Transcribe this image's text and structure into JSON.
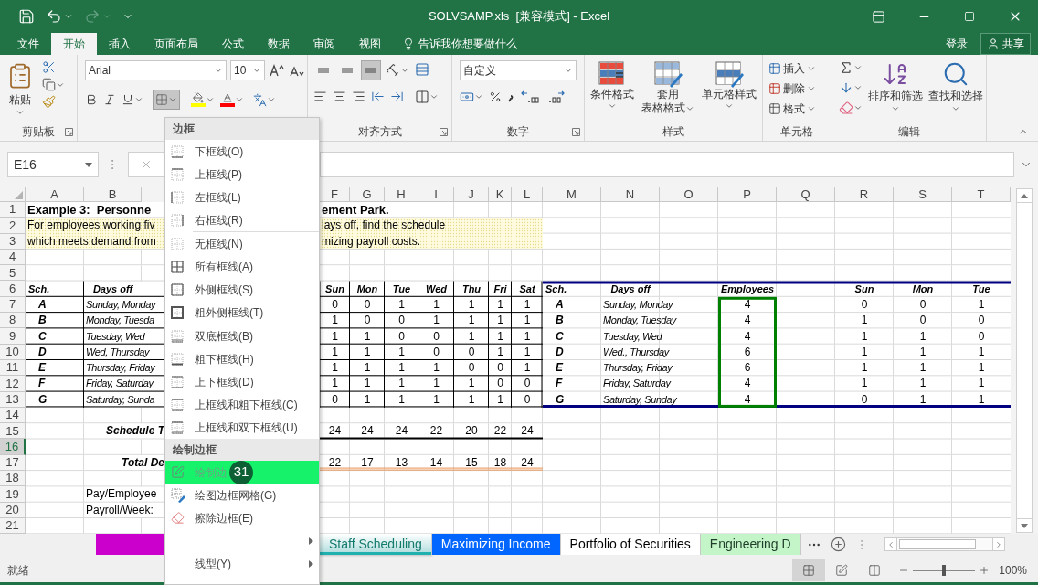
{
  "title_bar": {
    "title": "SOLVSAMP.xls  [兼容模式] - Excel",
    "redo_disabled": true
  },
  "menu_tabs": [
    {
      "label": "文件",
      "selected": false
    },
    {
      "label": "开始",
      "selected": true
    },
    {
      "label": "插入",
      "selected": false
    },
    {
      "label": "页面布局",
      "selected": false
    },
    {
      "label": "公式",
      "selected": false
    },
    {
      "label": "数据",
      "selected": false
    },
    {
      "label": "审阅",
      "selected": false
    },
    {
      "label": "视图",
      "selected": false
    }
  ],
  "tell_me": "告诉我你想要做什么",
  "sign_in": "登录",
  "share": "共享",
  "ribbon": {
    "clipboard": {
      "paste": "粘贴",
      "label": "剪贴板"
    },
    "font": {
      "name": "Arial",
      "size": "10",
      "borders_open": true
    },
    "alignment": {
      "vertical": [
        {
          "selected": false
        },
        {
          "selected": false
        },
        {
          "selected": true
        }
      ],
      "label": "对齐方式"
    },
    "number": {
      "format": "自定义",
      "label": "数字"
    },
    "styles": {
      "buttons": [
        {
          "label": "条件格式"
        },
        {
          "label": "套用",
          "label2": "表格格式"
        },
        {
          "label": "单元格样式"
        }
      ],
      "label": "样式"
    },
    "cells": {
      "buttons": [
        {
          "label": "插入"
        },
        {
          "label": "删除"
        },
        {
          "label": "格式"
        }
      ],
      "label": "单元格"
    },
    "editing": {
      "buttons": [
        {
          "label": "排序和筛选"
        },
        {
          "label": "查找和选择"
        }
      ],
      "label": "编辑"
    }
  },
  "formula_bar": {
    "name_box": "E16"
  },
  "column_headers": [
    "A",
    "B",
    "F",
    "G",
    "H",
    "I",
    "J",
    "K",
    "L",
    "M",
    "N",
    "O",
    "P",
    "Q",
    "R",
    "S",
    "T"
  ],
  "rows": [
    {
      "header": "1",
      "selected": false,
      "kind": "title",
      "cells": [
        "Example 3:  Personne",
        null,
        null,
        null,
        "ement Park."
      ]
    },
    {
      "header": "2",
      "selected": false,
      "kind": "note",
      "cells": [
        "For employees working fiv",
        null,
        null,
        null,
        "lays off, find the schedule"
      ]
    },
    {
      "header": "3",
      "selected": false,
      "kind": "note",
      "cells": [
        "which meets demand from",
        null,
        null,
        null,
        "mizing payroll costs."
      ]
    },
    {
      "header": "4",
      "selected": false,
      "kind": "blank"
    },
    {
      "header": "5",
      "selected": false,
      "kind": "blank"
    },
    {
      "header": "6",
      "selected": false,
      "kind": "header",
      "cells": [
        "Sch.",
        "Days off",
        null,
        null,
        "Sun",
        "Mon",
        "Tue",
        "Wed",
        "Thu",
        "Fri",
        "Sat",
        "Sch.",
        "Days off",
        null,
        "Employees",
        null,
        "Sun",
        "Mon",
        "Tue"
      ]
    },
    {
      "header": "7",
      "selected": false,
      "kind": "data",
      "cells": [
        "A",
        "Sunday, Monday",
        null,
        null,
        "0",
        "0",
        "1",
        "1",
        "1",
        "1",
        "1",
        "A",
        "Sunday, Monday",
        null,
        "4",
        null,
        "0",
        "0",
        "1"
      ]
    },
    {
      "header": "8",
      "selected": false,
      "kind": "data",
      "cells": [
        "B",
        "Monday, Tuesda",
        null,
        null,
        "1",
        "0",
        "0",
        "1",
        "1",
        "1",
        "1",
        "B",
        "Monday, Tuesday",
        null,
        "4",
        null,
        "1",
        "0",
        "0"
      ]
    },
    {
      "header": "9",
      "selected": false,
      "kind": "data",
      "cells": [
        "C",
        "Tuesday, Wed",
        null,
        null,
        "1",
        "1",
        "0",
        "0",
        "1",
        "1",
        "1",
        "C",
        "Tuesday, Wed",
        null,
        "4",
        null,
        "1",
        "1",
        "0"
      ]
    },
    {
      "header": "10",
      "selected": false,
      "kind": "data",
      "cells": [
        "D",
        "Wed, Thursday",
        null,
        null,
        "1",
        "1",
        "1",
        "0",
        "0",
        "1",
        "1",
        "D",
        "Wed., Thursday",
        null,
        "6",
        null,
        "1",
        "1",
        "1"
      ]
    },
    {
      "header": "11",
      "selected": false,
      "kind": "data",
      "cells": [
        "E",
        "Thursday, Friday",
        null,
        null,
        "1",
        "1",
        "1",
        "1",
        "0",
        "0",
        "1",
        "E",
        "Thursday, Friday",
        null,
        "6",
        null,
        "1",
        "1",
        "1"
      ]
    },
    {
      "header": "12",
      "selected": false,
      "kind": "data",
      "cells": [
        "F",
        "Friday, Saturday",
        null,
        null,
        "1",
        "1",
        "1",
        "1",
        "1",
        "0",
        "0",
        "F",
        "Friday, Saturday",
        null,
        "4",
        null,
        "1",
        "1",
        "1"
      ]
    },
    {
      "header": "13",
      "selected": false,
      "kind": "data_last",
      "cells": [
        "G",
        "Saturday, Sunda",
        null,
        null,
        "0",
        "1",
        "1",
        "1",
        "1",
        "1",
        "0",
        "G",
        "Saturday, Sunday",
        null,
        "4",
        null,
        "0",
        "1",
        "1"
      ]
    },
    {
      "header": "14",
      "selected": false,
      "kind": "blank"
    },
    {
      "header": "15",
      "selected": false,
      "kind": "total",
      "cells": [
        null,
        "Schedule T",
        null,
        null,
        "24",
        "24",
        "24",
        "22",
        "20",
        "22",
        "24"
      ]
    },
    {
      "header": "16",
      "selected": true,
      "kind": "blank"
    },
    {
      "header": "17",
      "selected": false,
      "kind": "total2",
      "cells": [
        null,
        "Total De",
        null,
        null,
        "22",
        "17",
        "13",
        "14",
        "15",
        "18",
        "24"
      ]
    },
    {
      "header": "18",
      "selected": false,
      "kind": "blank"
    },
    {
      "header": "19",
      "selected": false,
      "kind": "label",
      "cells": [
        null,
        "Pay/Employee"
      ]
    },
    {
      "header": "20",
      "selected": false,
      "kind": "label",
      "cells": [
        null,
        "Payroll/Week:"
      ]
    },
    {
      "header": "21",
      "selected": false,
      "kind": "blank"
    }
  ],
  "border_menu": {
    "sections": [
      {
        "header": "边框",
        "groups": [
          [
            {
              "label": "下框线(O)",
              "selected": false
            },
            {
              "label": "上框线(P)",
              "selected": false
            },
            {
              "label": "左框线(L)",
              "selected": false
            },
            {
              "label": "右框线(R)",
              "selected": false
            }
          ],
          [
            {
              "label": "无框线(N)",
              "selected": false
            },
            {
              "label": "所有框线(A)",
              "selected": false
            },
            {
              "label": "外侧框线(S)",
              "selected": false
            },
            {
              "label": "粗外侧框线(T)",
              "selected": false
            }
          ],
          [
            {
              "label": "双底框线(B)",
              "selected": false
            },
            {
              "label": "粗下框线(H)",
              "selected": false
            },
            {
              "label": "上下框线(D)",
              "selected": false
            },
            {
              "label": "上框线和粗下框线(C)",
              "selected": false
            },
            {
              "label": "上框线和双下框线(U)",
              "selected": false
            }
          ]
        ]
      },
      {
        "header": "绘制边框",
        "groups": [
          [
            {
              "label": "绘制边",
              "selected": true,
              "badge": "31",
              "submenu": false
            },
            {
              "label": "绘图边框网格(G)",
              "selected": false,
              "submenu": false
            },
            {
              "label": "擦除边框(E)",
              "selected": false,
              "submenu": false
            },
            {
              "selected": false,
              "submenu": true
            },
            {
              "label": "线型(Y)",
              "selected": false,
              "submenu": true
            }
          ]
        ]
      }
    ]
  },
  "sheet_tabs": [
    {
      "color": "#cc00cc",
      "selected": false
    },
    {
      "label": "Staff Scheduling",
      "color": "#20b0b0",
      "selected": true
    },
    {
      "label": "Maximizing Income",
      "color": "#0066ff",
      "selected": false
    },
    {
      "label": "Portfolio of Securities",
      "selected": false
    },
    {
      "label": "Engineering D",
      "color": "#c4f5c8",
      "selected": false
    }
  ],
  "status_bar": {
    "status": "就绪",
    "views": [
      {
        "selected": true
      },
      {
        "selected": false
      },
      {
        "selected": false
      }
    ],
    "zoom": {
      "level": 0.5,
      "reading": "100%"
    }
  }
}
